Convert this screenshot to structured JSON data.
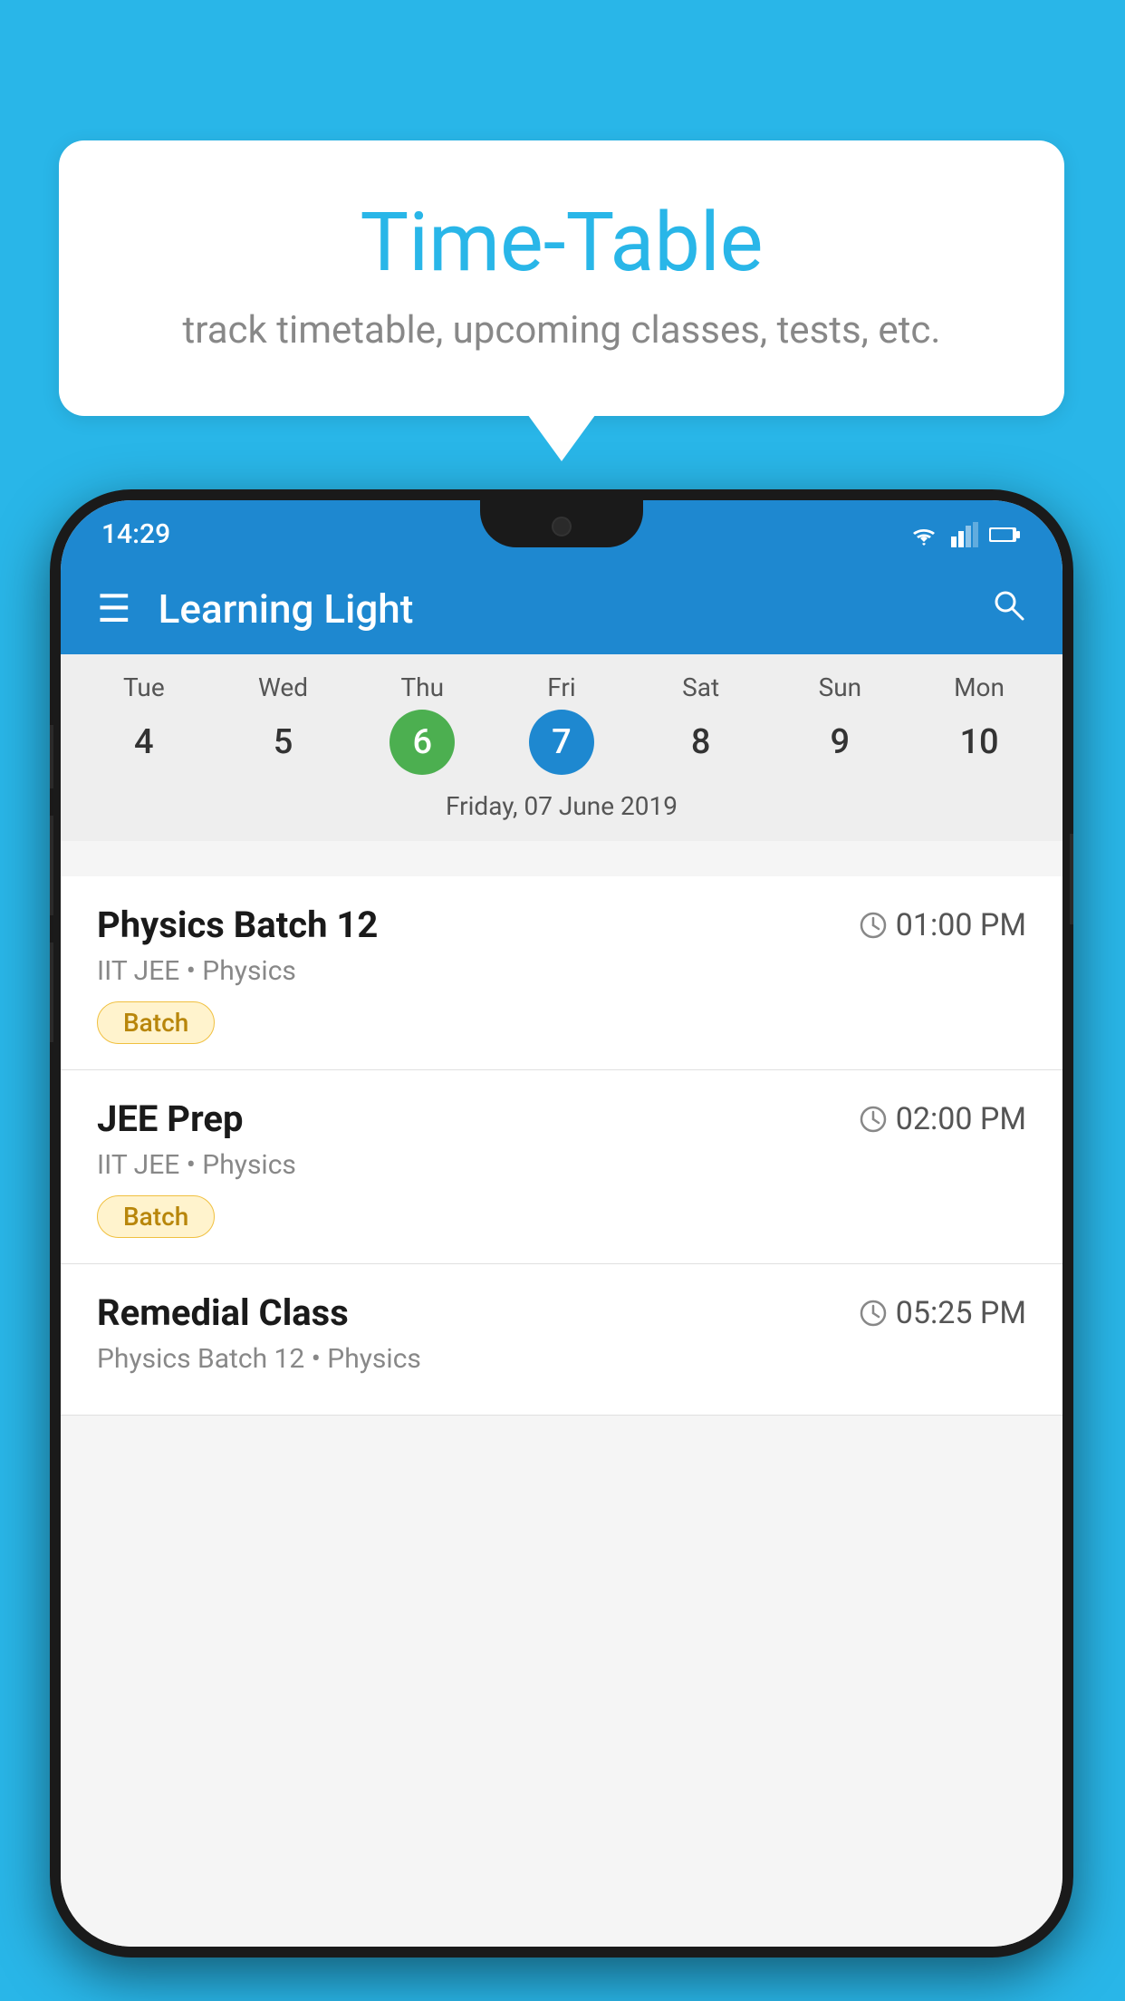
{
  "background_color": "#29b6e8",
  "tooltip": {
    "title": "Time-Table",
    "subtitle": "track timetable, upcoming classes, tests, etc."
  },
  "status_bar": {
    "time": "14:29"
  },
  "app_bar": {
    "title": "Learning Light",
    "menu_icon": "☰",
    "search_icon": "🔍"
  },
  "calendar": {
    "days": [
      {
        "name": "Tue",
        "num": "4",
        "state": "normal"
      },
      {
        "name": "Wed",
        "num": "5",
        "state": "normal"
      },
      {
        "name": "Thu",
        "num": "6",
        "state": "today"
      },
      {
        "name": "Fri",
        "num": "7",
        "state": "selected"
      },
      {
        "name": "Sat",
        "num": "8",
        "state": "normal"
      },
      {
        "name": "Sun",
        "num": "9",
        "state": "normal"
      },
      {
        "name": "Mon",
        "num": "10",
        "state": "normal"
      }
    ],
    "selected_date_label": "Friday, 07 June 2019"
  },
  "schedule_items": [
    {
      "title": "Physics Batch 12",
      "time": "01:00 PM",
      "subtitle": "IIT JEE • Physics",
      "tag": "Batch"
    },
    {
      "title": "JEE Prep",
      "time": "02:00 PM",
      "subtitle": "IIT JEE • Physics",
      "tag": "Batch"
    },
    {
      "title": "Remedial Class",
      "time": "05:25 PM",
      "subtitle": "Physics Batch 12 • Physics",
      "tag": null
    }
  ]
}
